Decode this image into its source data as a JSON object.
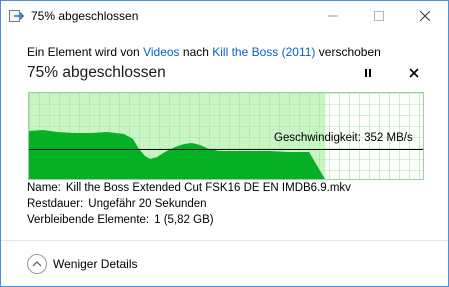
{
  "window": {
    "title": "75% abgeschlossen",
    "icon": "file-move-icon",
    "controls": {
      "minimize": "minimize-icon",
      "maximize": "maximize-icon",
      "close": "close-icon"
    }
  },
  "operation": {
    "prefix": "Ein Element wird von",
    "source": "Videos",
    "middle": "nach",
    "destination": "Kill the Boss (2011)",
    "suffix": "verschoben"
  },
  "progress": {
    "heading": "75% abgeschlossen",
    "percent": 75,
    "speed_label": "Geschwindigkeit:",
    "speed_value": "352 MB/s",
    "pause_icon": "pause-icon",
    "cancel_icon": "cancel-icon"
  },
  "colors": {
    "progress_fill": "#c9f5c5",
    "graph_fill": "#06b025",
    "grid": "#a8e3a8",
    "link": "#0a5fcb"
  },
  "details": {
    "name_label": "Name:",
    "name_value": "Kill the Boss Extended Cut FSK16 DE EN IMDB6.9.mkv",
    "time_label": "Restdauer:",
    "time_value": "Ungefähr 20 Sekunden",
    "items_label": "Verbleibende Elemente:",
    "items_value": "1 (5,82 GB)"
  },
  "footer": {
    "toggle_label": "Weniger Details",
    "toggle_icon": "chevron-up-icon"
  }
}
